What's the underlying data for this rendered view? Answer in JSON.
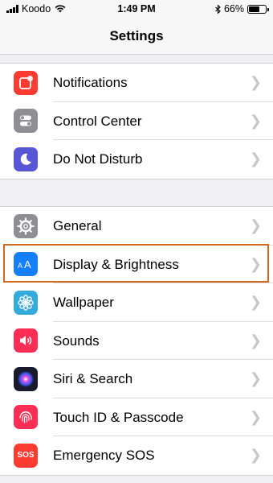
{
  "status_bar": {
    "carrier": "Koodo",
    "time": "1:49 PM",
    "battery_percent": "66%",
    "battery_level": 0.66,
    "icons": [
      "signal-icon",
      "wifi-icon",
      "bluetooth-icon",
      "battery-icon"
    ]
  },
  "nav": {
    "title": "Settings"
  },
  "groups": [
    {
      "items": [
        {
          "label": "Notifications",
          "icon": "notifications-icon",
          "color": "#fe3b30"
        },
        {
          "label": "Control Center",
          "icon": "control-center-icon",
          "color": "#8e8e93"
        },
        {
          "label": "Do Not Disturb",
          "icon": "moon-icon",
          "color": "#5856d6"
        }
      ]
    },
    {
      "items": [
        {
          "label": "General",
          "icon": "gear-icon",
          "color": "#8e8e93"
        },
        {
          "label": "Display & Brightness",
          "icon": "display-brightness-icon",
          "color": "#147efb",
          "highlighted": true
        },
        {
          "label": "Wallpaper",
          "icon": "wallpaper-flower-icon",
          "color": "#35aadc"
        },
        {
          "label": "Sounds",
          "icon": "speaker-icon",
          "color": "#fe2d55"
        },
        {
          "label": "Siri & Search",
          "icon": "siri-icon",
          "color": "#1a1a2e"
        },
        {
          "label": "Touch ID & Passcode",
          "icon": "fingerprint-icon",
          "color": "#fe2d55"
        },
        {
          "label": "Emergency SOS",
          "icon": "sos-icon",
          "color": "#fe3b30",
          "icon_text": "SOS"
        }
      ]
    }
  ],
  "colors": {
    "highlight": "#d2691e",
    "chevron": "#c7c7cc"
  }
}
